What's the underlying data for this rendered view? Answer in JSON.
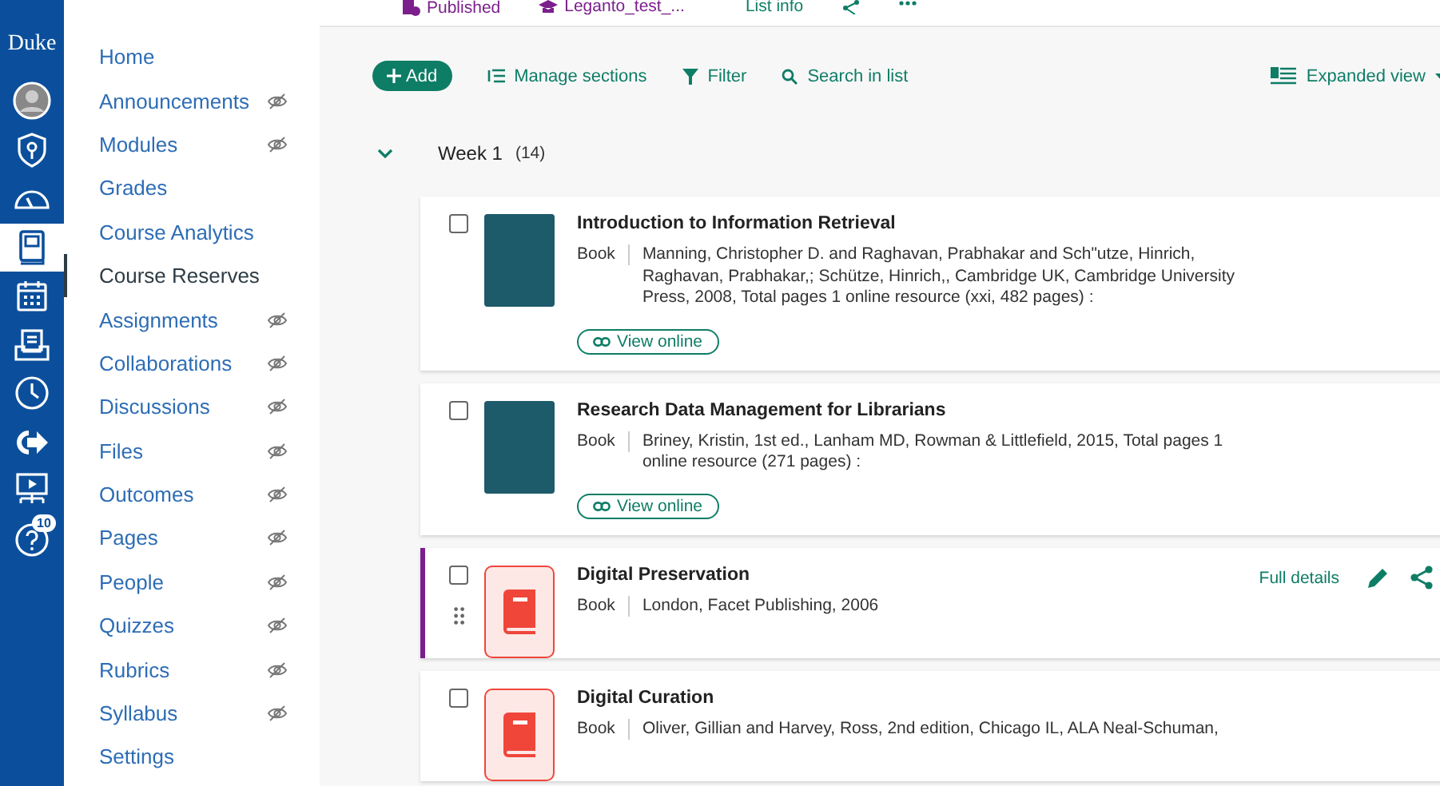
{
  "rail": {
    "logo": "Duke",
    "items": [
      {
        "kind": "avatar",
        "selected": false
      },
      {
        "kind": "shield",
        "selected": false
      },
      {
        "kind": "dashboard",
        "selected": false
      },
      {
        "kind": "courses",
        "selected": true
      },
      {
        "kind": "calendar",
        "selected": false
      },
      {
        "kind": "inbox",
        "selected": false
      },
      {
        "kind": "history",
        "selected": false
      },
      {
        "kind": "arrow",
        "selected": false
      },
      {
        "kind": "presentation",
        "selected": false
      },
      {
        "kind": "help",
        "selected": false,
        "badge": "10"
      }
    ]
  },
  "course_nav": [
    {
      "label": "Home",
      "hidden": false,
      "selected": false
    },
    {
      "label": "Announcements",
      "hidden": true,
      "selected": false
    },
    {
      "label": "Modules",
      "hidden": true,
      "selected": false
    },
    {
      "label": "Grades",
      "hidden": false,
      "selected": false
    },
    {
      "label": "Course Analytics",
      "hidden": false,
      "selected": false
    },
    {
      "label": "Course Reserves",
      "hidden": false,
      "selected": true
    },
    {
      "label": "Assignments",
      "hidden": true,
      "selected": false
    },
    {
      "label": "Collaborations",
      "hidden": true,
      "selected": false
    },
    {
      "label": "Discussions",
      "hidden": true,
      "selected": false
    },
    {
      "label": "Files",
      "hidden": true,
      "selected": false
    },
    {
      "label": "Outcomes",
      "hidden": true,
      "selected": false
    },
    {
      "label": "Pages",
      "hidden": true,
      "selected": false
    },
    {
      "label": "People",
      "hidden": true,
      "selected": false
    },
    {
      "label": "Quizzes",
      "hidden": true,
      "selected": false
    },
    {
      "label": "Rubrics",
      "hidden": true,
      "selected": false
    },
    {
      "label": "Syllabus",
      "hidden": true,
      "selected": false
    },
    {
      "label": "Settings",
      "hidden": false,
      "selected": false
    }
  ],
  "header": {
    "status": "Published",
    "course": "Leganto_test_...",
    "list_info": "List info"
  },
  "toolbar": {
    "add": "Add",
    "manage": "Manage sections",
    "filter": "Filter",
    "search": "Search in list",
    "view": "Expanded view"
  },
  "section": {
    "title": "Week 1",
    "count": "(14)",
    "expanded": true
  },
  "items": [
    {
      "title": "Introduction to Information Retrieval",
      "type": "Book",
      "details": "Manning, Christopher D. and Raghavan, Prabhakar and Sch\"utze, Hinrich, Raghavan, Prabhakar,; Schütze, Hinrich,, Cambridge UK, Cambridge University Press, 2008, Total pages 1 online resource (xxi, 482 pages) :",
      "kind": "photo",
      "link": "View online",
      "checked": false,
      "focused": false
    },
    {
      "title": "Research Data Management for Librarians",
      "type": "Book",
      "details": "Briney, Kristin, 1st ed., Lanham MD, Rowman & Littlefield, 2015, Total pages 1 online resource (271 pages) :",
      "kind": "photo",
      "link": "View online",
      "checked": false,
      "focused": false
    },
    {
      "title": "Digital Preservation",
      "type": "Book",
      "details": "London, Facet Publishing, 2006",
      "kind": "book",
      "actions": "Full details",
      "checked": false,
      "focused": true
    },
    {
      "title": "Digital Curation",
      "type": "Book",
      "details": "Oliver, Gillian and Harvey, Ross, 2nd edition, Chicago IL, ALA Neal-Schuman,",
      "kind": "book",
      "checked": false,
      "focused": false
    }
  ]
}
